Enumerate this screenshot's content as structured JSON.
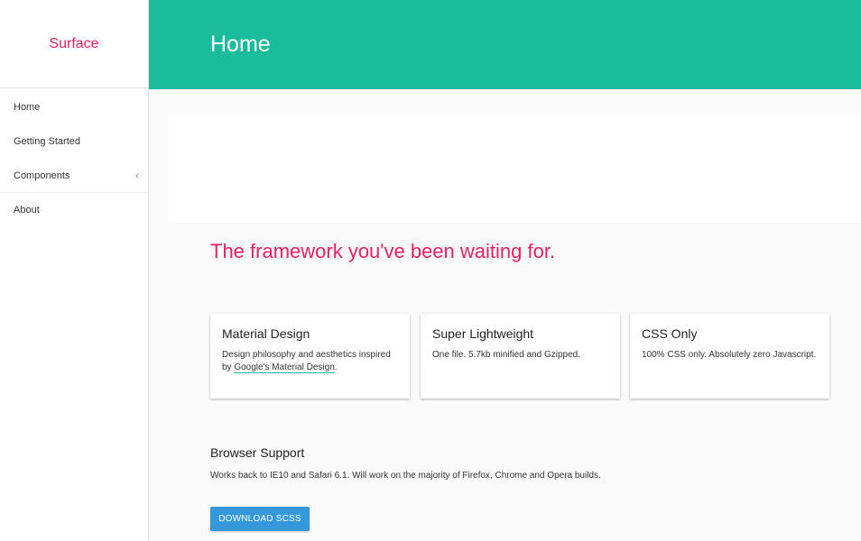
{
  "sidebar": {
    "brand": "Surface",
    "items": [
      {
        "label": "Home"
      },
      {
        "label": "Getting Started"
      },
      {
        "label": "Components",
        "chevron": "‹"
      },
      {
        "label": "About"
      }
    ]
  },
  "header": {
    "title": "Home"
  },
  "main": {
    "tagline": "The framework you've been waiting for.",
    "cards": [
      {
        "title": "Material Design",
        "text_before": "Design philosophy and aesthetics inspired by ",
        "link": "Google's Material Design",
        "text_after": "."
      },
      {
        "title": "Super Lightweight",
        "text": "One file. 5.7kb minified and Gzipped."
      },
      {
        "title": "CSS Only",
        "text": "100% CSS only. Absolutely zero Javascript."
      }
    ],
    "support": {
      "title": "Browser Support",
      "text": "Works back to IE10 and Safari 6.1. Will work on the majority of Firefox, Chrome and Opera builds."
    },
    "download_label": "Download SCSS"
  },
  "colors": {
    "accent": "#1abc9c",
    "brand": "#e91e63",
    "button": "#3498db"
  },
  "icons": {
    "components_chevron": "chevron-left-icon"
  }
}
